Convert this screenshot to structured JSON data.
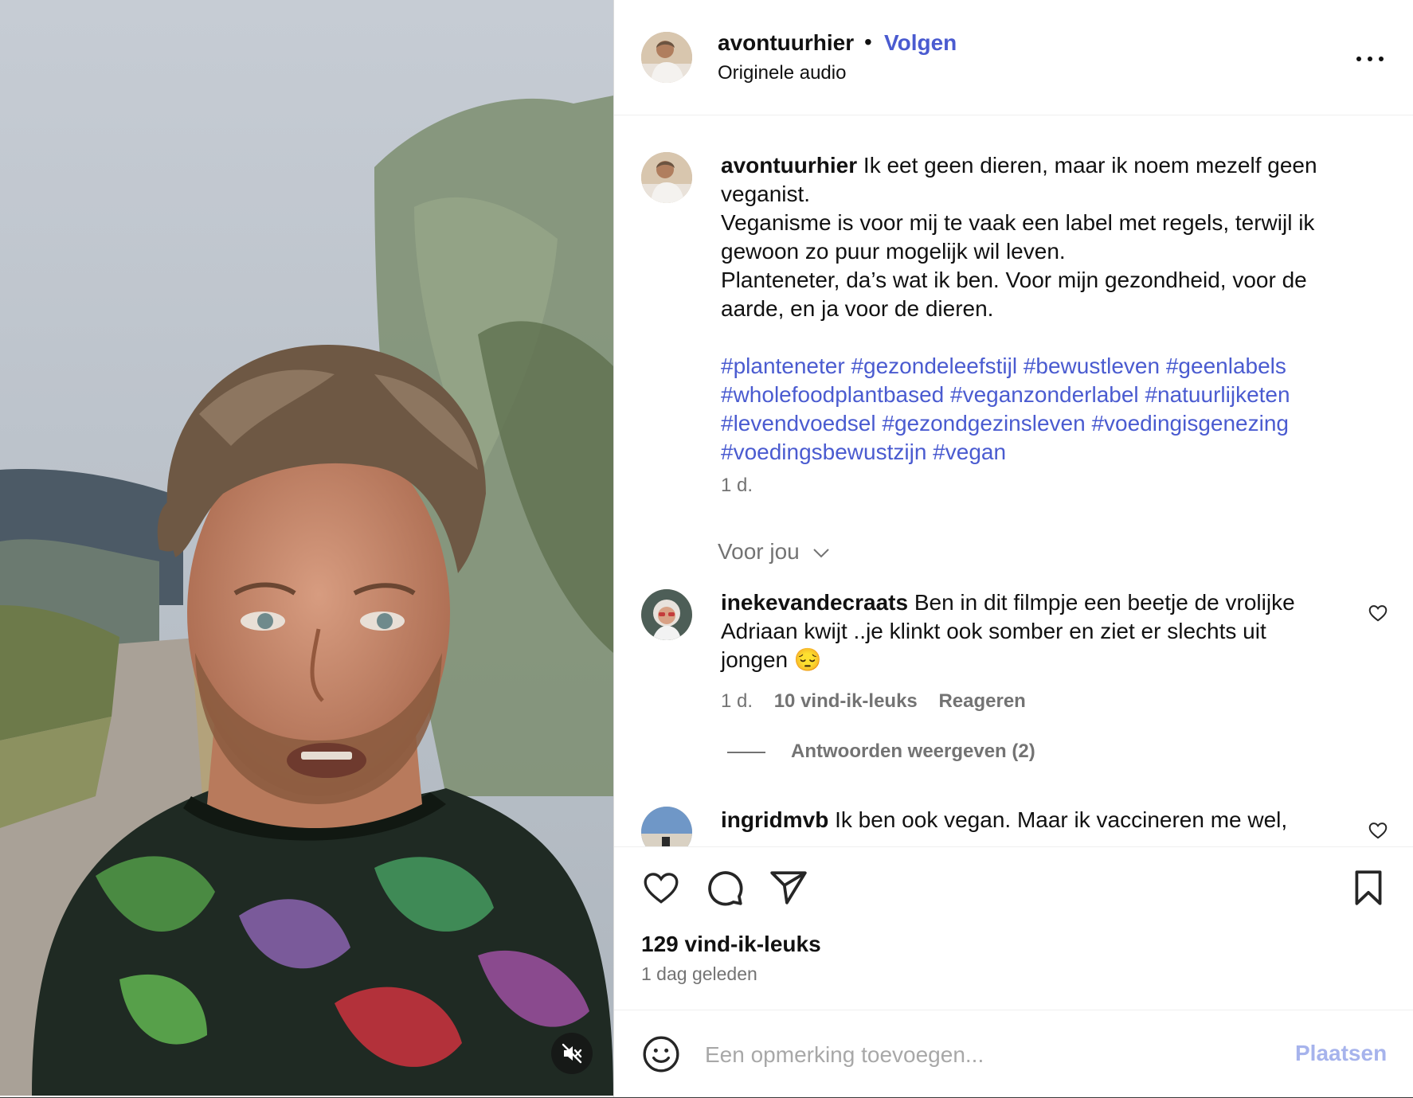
{
  "header": {
    "username": "avontuurhier",
    "separator": "•",
    "follow_label": "Volgen",
    "audio_label": "Originele audio"
  },
  "caption": {
    "username": "avontuurhier",
    "line1": "Ik eet geen dieren, maar ik noem mezelf geen veganist.",
    "line2": "Veganisme is voor mij te vaak een label met regels, terwijl ik gewoon zo puur mogelijk wil leven.",
    "line3": "Planteneter, da’s wat ik ben. Voor mijn gezondheid, voor de aarde, en ja voor de dieren.",
    "hashtags": [
      "#planteneter",
      "#gezondeleefstijl",
      "#bewustleven",
      "#geenlabels",
      "#wholefoodplantbased",
      "#veganzonderlabel",
      "#natuurlijketen",
      "#levendvoedsel",
      "#gezondgezinsleven",
      "#voedingisgenezing",
      "#voedingsbewustzijn",
      "#vegan"
    ],
    "time": "1 d."
  },
  "filter_label": "Voor jou",
  "comments": [
    {
      "username": "inekevandecraats",
      "text": "Ben in dit filmpje een beetje de vrolijke Adriaan kwijt ..je klinkt ook somber en ziet er slechts uit jongen 😔",
      "time": "1 d.",
      "likes": "10 vind-ik-leuks",
      "reply_label": "Reageren",
      "view_replies": "Antwoorden weergeven (2)"
    },
    {
      "username": "ingridmvb",
      "text": "Ik ben ook vegan. Maar ik vaccineren me wel,"
    }
  ],
  "actions": {
    "likes": "129 vind-ik-leuks",
    "posted": "1 dag geleden"
  },
  "composer": {
    "placeholder": "Een opmerking toevoegen...",
    "post_label": "Plaatsen"
  },
  "icons": [
    "mute-icon",
    "more-icon",
    "heart-icon",
    "comment-icon",
    "share-icon",
    "bookmark-icon",
    "emoji-icon"
  ],
  "colors": {
    "link": "#4a5bd0",
    "muted": "#737373",
    "post_disabled": "#a6b3ec"
  }
}
